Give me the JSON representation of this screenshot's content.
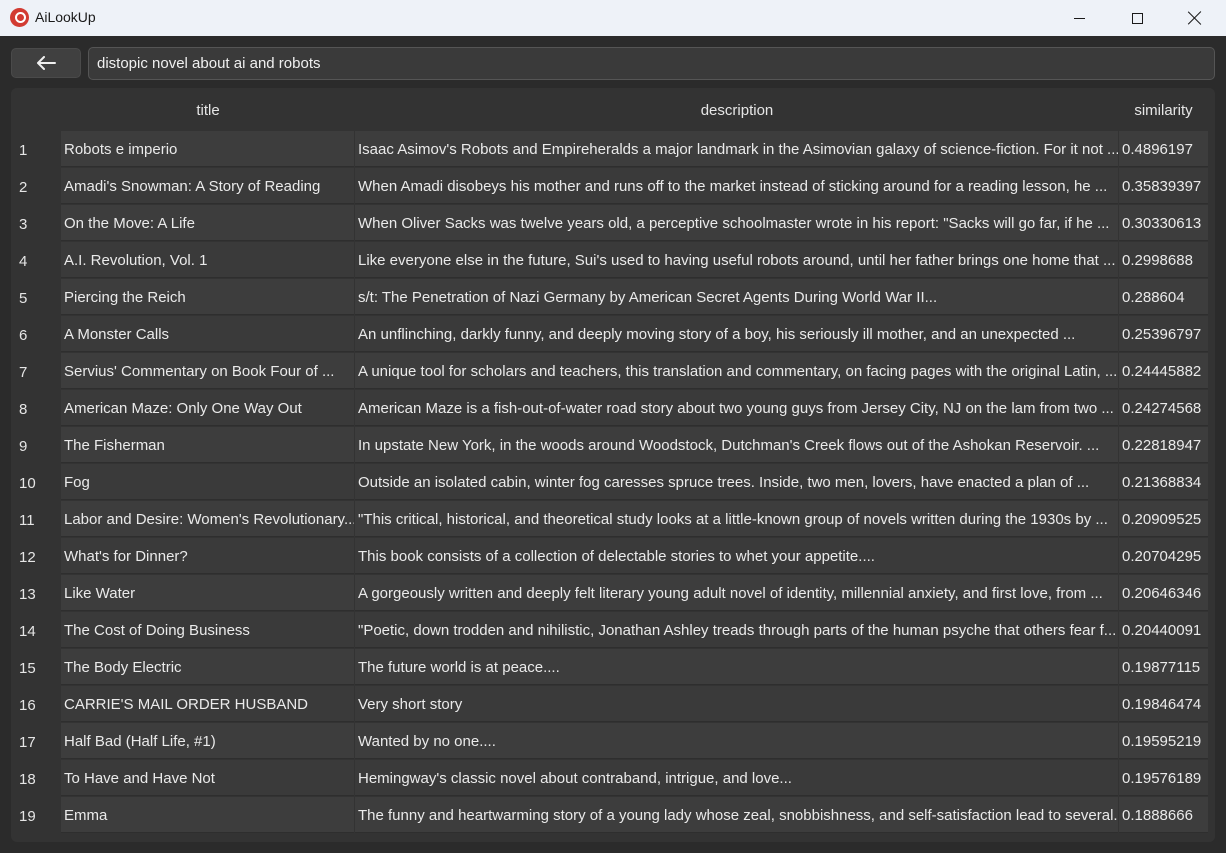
{
  "window": {
    "title": "AiLookUp",
    "icon": "app-logo-icon"
  },
  "toolbar": {
    "back_icon": "arrow-left-icon",
    "search_value": "distopic novel about ai and robots"
  },
  "table": {
    "columns": [
      "title",
      "description",
      "similarity"
    ],
    "rows": [
      {
        "n": "1",
        "title": "Robots e imperio",
        "description": "Isaac Asimov's Robots and Empireheralds a major landmark in the Asimovian galaxy of science-fiction. For it not ...",
        "similarity": "0.4896197"
      },
      {
        "n": "2",
        "title": "Amadi's Snowman: A Story of Reading",
        "description": "When Amadi disobeys his mother and runs off to the market instead of sticking around for a reading lesson, he ...",
        "similarity": "0.35839397"
      },
      {
        "n": "3",
        "title": "On the Move: A Life",
        "description": "When Oliver Sacks was twelve years old, a perceptive schoolmaster wrote in his report: \"Sacks will go far, if he ...",
        "similarity": "0.30330613"
      },
      {
        "n": "4",
        "title": "A.I. Revolution, Vol. 1",
        "description": "Like everyone else in the future, Sui's used to having useful robots around, until her father brings one home that ...",
        "similarity": "0.2998688"
      },
      {
        "n": "5",
        "title": "Piercing the Reich",
        "description": "s/t: The Penetration of Nazi Germany by American Secret Agents During World War II...",
        "similarity": "0.288604"
      },
      {
        "n": "6",
        "title": "A Monster Calls",
        "description": "An unflinching, darkly funny, and deeply moving story of a boy, his seriously ill mother, and an unexpected ...",
        "similarity": "0.25396797"
      },
      {
        "n": "7",
        "title": "Servius' Commentary on Book Four of ...",
        "description": "A unique tool for scholars and teachers, this translation and commentary, on facing pages with the original Latin, ...",
        "similarity": "0.24445882"
      },
      {
        "n": "8",
        "title": "American Maze: Only One Way Out",
        "description": "American Maze is a fish-out-of-water road story about two young guys from Jersey City, NJ on the lam from two ...",
        "similarity": "0.24274568"
      },
      {
        "n": "9",
        "title": "The Fisherman",
        "description": "In upstate New York, in the woods around Woodstock, Dutchman's Creek flows out of the Ashokan Reservoir. ...",
        "similarity": "0.22818947"
      },
      {
        "n": "10",
        "title": "Fog",
        "description": "Outside an isolated cabin, winter fog caresses spruce trees. Inside, two men, lovers, have enacted a plan of ...",
        "similarity": "0.21368834"
      },
      {
        "n": "11",
        "title": "Labor and Desire: Women's Revolutionary...",
        "description": "\"This critical, historical, and theoretical study looks at a little-known group of novels written during the 1930s by ...",
        "similarity": "0.20909525"
      },
      {
        "n": "12",
        "title": "What's for Dinner?",
        "description": "This book consists of a collection of delectable stories to whet your appetite....",
        "similarity": "0.20704295"
      },
      {
        "n": "13",
        "title": "Like Water",
        "description": "A gorgeously written and deeply felt literary young adult novel of identity, millennial anxiety, and first love, from ...",
        "similarity": "0.20646346"
      },
      {
        "n": "14",
        "title": "The Cost of Doing Business",
        "description": "\"Poetic, down trodden and nihilistic, Jonathan Ashley treads through parts of the human psyche that others fear f...",
        "similarity": "0.20440091"
      },
      {
        "n": "15",
        "title": "The Body Electric",
        "description": "The future world is at peace....",
        "similarity": "0.19877115"
      },
      {
        "n": "16",
        "title": "CARRIE'S MAIL ORDER HUSBAND",
        "description": "Very short story",
        "similarity": "0.19846474"
      },
      {
        "n": "17",
        "title": "Half Bad (Half Life, #1)",
        "description": "Wanted by no one....",
        "similarity": "0.19595219"
      },
      {
        "n": "18",
        "title": "To Have and Have Not",
        "description": "Hemingway's classic novel about contraband, intrigue, and love...",
        "similarity": "0.19576189"
      },
      {
        "n": "19",
        "title": "Emma",
        "description": "The funny and heartwarming story of a young lady whose zeal, snobbishness, and self-satisfaction lead to several...",
        "similarity": "0.1888666"
      }
    ]
  }
}
